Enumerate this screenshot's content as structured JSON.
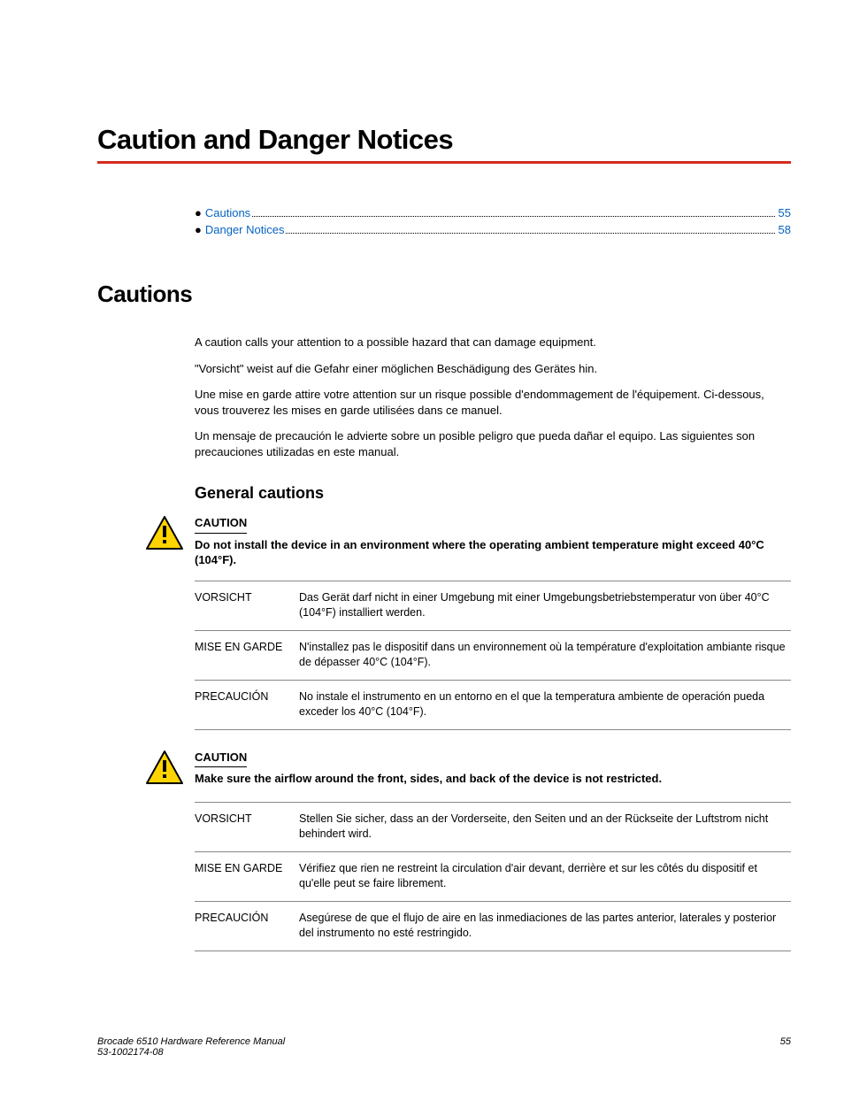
{
  "title": "Caution and Danger Notices",
  "toc": [
    {
      "label": "Cautions",
      "page": "55"
    },
    {
      "label": "Danger Notices",
      "page": "58"
    }
  ],
  "cautions_heading": "Cautions",
  "intro": [
    "A caution calls your attention to a possible hazard that can damage equipment.",
    "\"Vorsicht\" weist auf die Gefahr einer möglichen Beschädigung des Gerätes hin.",
    "Une mise en garde attire votre attention sur un risque possible d'endommagement de l'équipement. Ci-dessous, vous trouverez les mises en garde utilisées dans ce manuel.",
    "Un mensaje de precaución le advierte sobre un posible peligro que pueda dañar el equipo. Las siguientes son precauciones utilizadas en este manual."
  ],
  "general_heading": "General cautions",
  "caution_label": "CAUTION",
  "caution1": {
    "msg": "Do not install the device in an environment where the operating ambient temperature might exceed 40°C (104°F).",
    "rows": [
      {
        "lang": "VORSICHT",
        "text": "Das Gerät darf nicht in einer Umgebung mit einer Umgebungsbetriebstemperatur von über 40°C (104°F) installiert werden."
      },
      {
        "lang": "MISE EN GARDE",
        "text": "N'installez pas le dispositif dans un environnement où la température d'exploitation ambiante risque de dépasser 40°C (104°F)."
      },
      {
        "lang": "PRECAUCIÓN",
        "text": "No instale el instrumento en un entorno en el que la temperatura ambiente de operación pueda exceder los 40°C (104°F)."
      }
    ]
  },
  "caution2": {
    "msg": "Make sure the airflow around the front, sides, and back of the device is not restricted.",
    "rows": [
      {
        "lang": "VORSICHT",
        "text": "Stellen Sie sicher, dass an der Vorderseite, den Seiten und an der Rückseite der Luftstrom nicht behindert wird."
      },
      {
        "lang": "MISE EN GARDE",
        "text": "Vérifiez que rien ne restreint la circulation d'air devant, derrière et sur les côtés du dispositif et qu'elle peut se faire librement."
      },
      {
        "lang": "PRECAUCIÓN",
        "text": "Asegúrese de que el flujo de aire en las inmediaciones de las partes anterior, laterales y posterior del instrumento no esté restringido."
      }
    ]
  },
  "footer": {
    "manual": "Brocade 6510 Hardware Reference Manual",
    "docnum": "53-1002174-08",
    "page": "55"
  }
}
